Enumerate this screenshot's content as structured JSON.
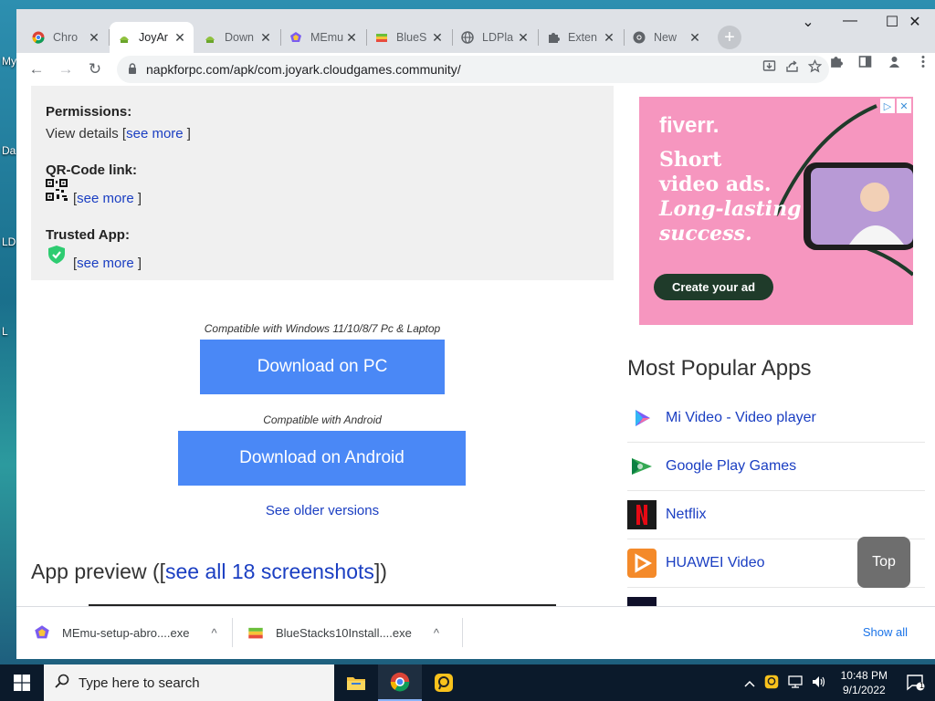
{
  "desktop": {
    "labels": [
      "My",
      "Da",
      "LD",
      "L"
    ]
  },
  "window": {
    "controls": {
      "collapse": "⌄",
      "minimize": "—",
      "maximize": "☐",
      "close": "✕"
    }
  },
  "tabs": [
    {
      "label": "Chro",
      "icon": "chrome-icon"
    },
    {
      "label": "JoyAr",
      "icon": "joyark-icon",
      "active": true
    },
    {
      "label": "Down",
      "icon": "android-icon"
    },
    {
      "label": "MEmu",
      "icon": "memu-icon"
    },
    {
      "label": "BlueS",
      "icon": "bluestacks-icon"
    },
    {
      "label": "LDPla",
      "icon": "globe-icon"
    },
    {
      "label": "Exten",
      "icon": "puzzle-icon"
    },
    {
      "label": "New",
      "icon": "chrome-icon"
    }
  ],
  "tab_close": "✕",
  "new_tab": "+",
  "toolbar": {
    "back": "←",
    "forward": "→",
    "reload": "↻",
    "url": "napkforpc.com/apk/com.joyark.cloudgames.community/"
  },
  "info": {
    "permissions_label": "Permissions:",
    "permissions_text": "View details [",
    "see_more": "see more",
    "bracket_close": " ]",
    "qr_label": "QR-Code link:",
    "qr_prefix": "[",
    "trusted_label": "Trusted App:",
    "trusted_prefix": "["
  },
  "download": {
    "pc_compat": "Compatible with Windows 11/10/8/7 Pc & Laptop",
    "pc_button": "Download on PC",
    "android_compat": "Compatible with Android",
    "android_button": "Download on Android",
    "older": "See older versions"
  },
  "preview": {
    "prefix": "App preview ([",
    "link": "see all 18 screenshots",
    "suffix": "])"
  },
  "ad": {
    "brand": "fiverr.",
    "line1": "Short",
    "line2": "video ads.",
    "line3": "Long-lasting",
    "line4": "success.",
    "cta": "Create your ad",
    "badge_play": "▷",
    "badge_close": "✕"
  },
  "popular": {
    "title": "Most Popular Apps",
    "apps": [
      {
        "name": "Mi Video - Video player",
        "icon": "mi-video-icon"
      },
      {
        "name": "Google Play Games",
        "icon": "play-games-icon"
      },
      {
        "name": "Netflix",
        "icon": "netflix-icon"
      },
      {
        "name": "HUAWEI Video",
        "icon": "huawei-video-icon"
      }
    ]
  },
  "top_button": "Top",
  "shelf": {
    "items": [
      {
        "name": "MEmu-setup-abro....exe"
      },
      {
        "name": "BlueStacks10Install....exe"
      }
    ],
    "caret": "^",
    "show_all": "Show all"
  },
  "taskbar": {
    "search_placeholder": "Type here to search",
    "time": "10:48 PM",
    "date": "9/1/2022",
    "notif_count": "1"
  }
}
